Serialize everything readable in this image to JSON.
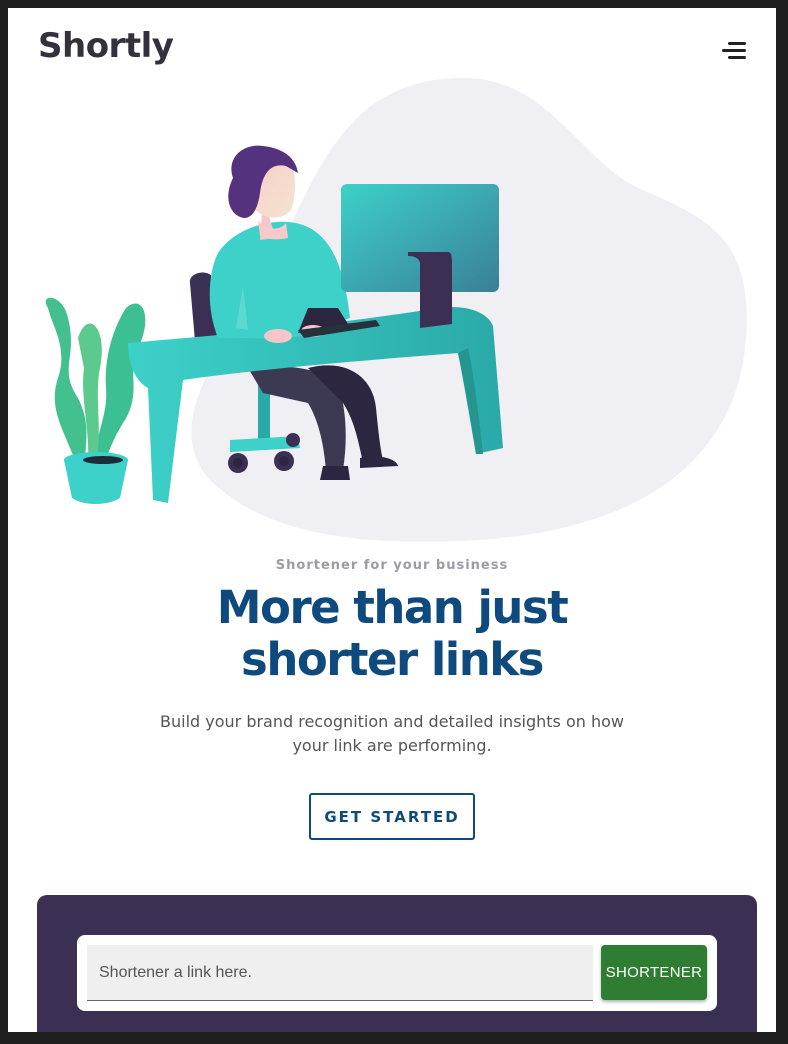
{
  "header": {
    "logo_text": "Shortly",
    "menu_icon": "hamburger-menu-icon"
  },
  "hero": {
    "illustration": "person-working-at-desk-illustration",
    "tagline": "Shortener for your business",
    "headline_line1": "More than just",
    "headline_line2": "shorter links",
    "subtext": "Build your brand recognition and detailed insights on how your link are performing.",
    "cta_label": "GET STARTED"
  },
  "shortener": {
    "input_placeholder": "Shortener a link here.",
    "input_value": "",
    "button_label": "SHORTENER"
  },
  "colors": {
    "headline": "#0e4a7e",
    "panel_bg": "#3b3054",
    "button_bg": "#2e7d32",
    "accent_cyan": "#3dd1c9"
  }
}
